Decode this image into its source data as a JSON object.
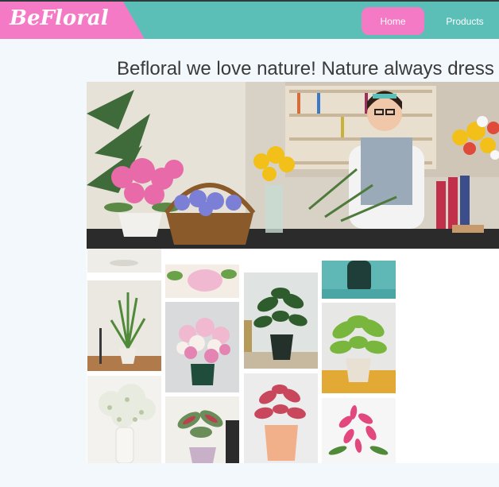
{
  "header": {
    "logo_text": "BeFloral",
    "nav": [
      {
        "label": "Home",
        "active": true
      },
      {
        "label": "Products",
        "active": false
      }
    ],
    "colors": {
      "bar": "#5bbfb8",
      "accent": "#f57ac5"
    }
  },
  "main": {
    "headline": "Befloral we love nature! Nature always dress"
  }
}
